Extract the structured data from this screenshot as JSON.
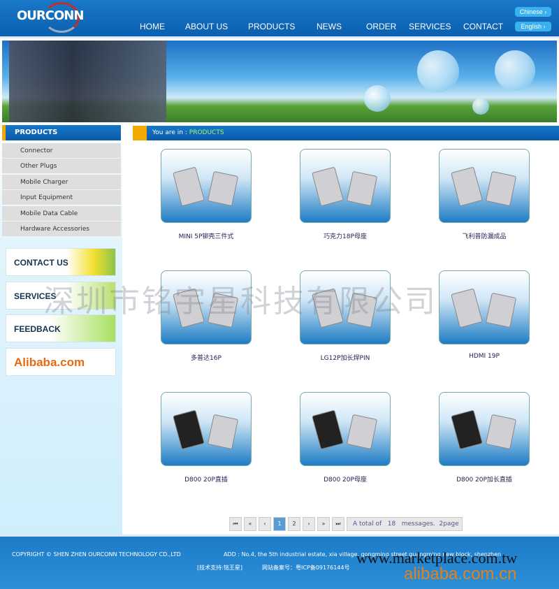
{
  "header": {
    "logo": "OURCONN",
    "nav": [
      "HOME",
      "ABOUT US",
      "PRODUCTS",
      "NEWS",
      "ORDER",
      "SERVICES",
      "CONTACT"
    ],
    "lang": [
      "Chinese",
      "English"
    ]
  },
  "sidebar": {
    "title": "PRODUCTS",
    "items": [
      "Connector",
      "Other Plugs",
      "Mobile Charger",
      "Input Equipment",
      "Mobile Data Cable",
      "Hardware Accessories"
    ],
    "promos": [
      "CONTACT US",
      "SERVICES",
      "FEEDBACK",
      "Alibaba.com"
    ]
  },
  "breadcrumb": {
    "prefix": "You are in :",
    "current": "PRODUCTS"
  },
  "products": [
    "MINI 5P铆壳三件式",
    "巧克力18P母座",
    "飞利普防漏成品",
    "多普达16P",
    "LG12P加长焊PIN",
    "HDMI 19P",
    "D800 20P直插",
    "D800 20P母座",
    "D800 20P加长直插"
  ],
  "pagination": {
    "buttons": [
      "first",
      "prev-block",
      "prev",
      "1",
      "2",
      "next",
      "next-block",
      "last"
    ],
    "current": "1",
    "total": "A total of   18   messages.  2page"
  },
  "footer": {
    "copyright": "COPYRIGHT ©  SHEN ZHEN OURCONN TECHNOLOGY CD.,LTD",
    "address": "ADD : No.4, the 5th industrial estate, xia village, gongming street,guangming new block, shenzhen",
    "support": "[技术支持:铭王星]",
    "icp": "网站备案号：粤ICP备09176144号"
  },
  "watermarks": [
    "深圳市铭宇星科技有限公司",
    "www.marketplace.com.tw",
    "alibaba.com.cn"
  ],
  "colors": {
    "header": "#0a5fb0",
    "accent": "#f2a900",
    "link": "#a8f070"
  }
}
